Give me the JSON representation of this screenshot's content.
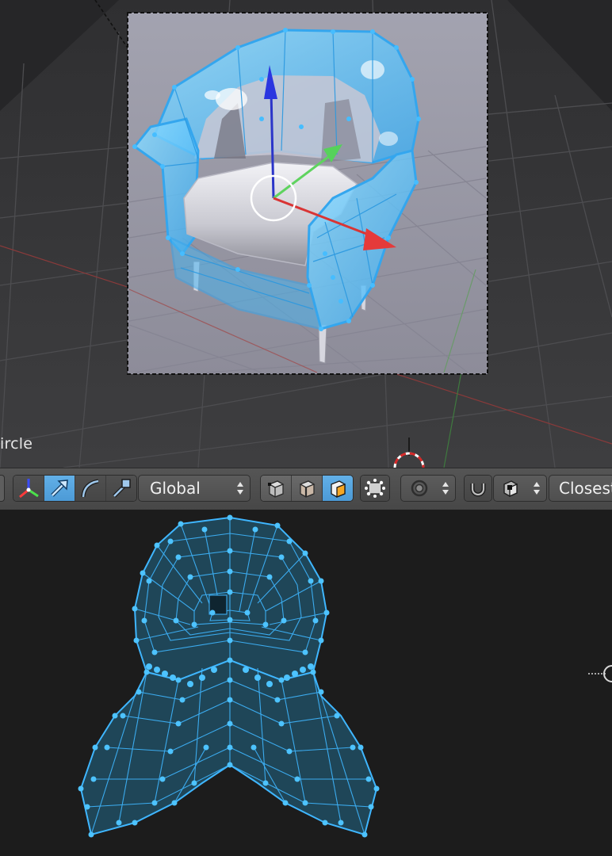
{
  "viewport": {
    "object_label": "ircle",
    "colors": {
      "background": "#3b3b3d",
      "grid": "#4c4c4e",
      "selection": "#3fb6ff",
      "render_bg": "#9a99a6"
    }
  },
  "toolbar": {
    "transform_orientation": "Global",
    "snap_element": "Closest",
    "icons": [
      "manipulator-axes-icon",
      "translate-arrow-icon",
      "rotate-arc-icon",
      "scale-handle-icon",
      "vertex-select-icon",
      "edge-select-icon",
      "face-select-icon",
      "occlude-geometry-icon",
      "proportional-edit-icon",
      "snap-magnet-icon",
      "snap-target-icon"
    ],
    "colors": {
      "active": "#5aa8e3",
      "panel": "#4a4a4a"
    }
  },
  "uv_editor": {
    "colors": {
      "background": "#1c1c1c",
      "mesh_fill": "#234a5c",
      "mesh_edges": "#3fb6ff",
      "vertices": "#4dc3ff"
    }
  }
}
